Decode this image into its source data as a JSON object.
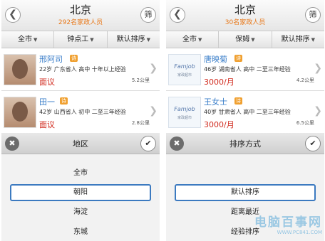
{
  "panels": [
    {
      "title": "北京",
      "subtitle": "292名家政人员",
      "back_icon": "chevron-left-icon",
      "filter_label": "筛",
      "tabs": [
        "全市",
        "钟点工",
        "默认排序"
      ],
      "items": [
        {
          "name": "邢阿司",
          "badge": "诗",
          "info": "22岁 广东省人 高中 十年以上经验",
          "price": "面议",
          "distance": "5.2公里",
          "avatar": "photo"
        },
        {
          "name": "田一",
          "badge": "诗",
          "info": "42岁 山西省人 初中 二至三年经验",
          "price": "面议",
          "distance": "2.8公里",
          "avatar": "photo"
        }
      ],
      "sheet": {
        "title": "地区",
        "close_icon": "close-icon",
        "confirm_icon": "check-icon",
        "options": [
          "全市",
          "朝阳",
          "海淀",
          "东城"
        ],
        "selected_index": 1
      }
    },
    {
      "title": "北京",
      "subtitle": "30名家政人员",
      "back_icon": "chevron-left-icon",
      "filter_label": "筛",
      "tabs": [
        "全市",
        "保姆",
        "默认排序"
      ],
      "items": [
        {
          "name": "唐映菊",
          "badge": "诗",
          "info": "46岁 湖南省人 高中 二至三年经验",
          "price": "3000/月",
          "distance": "4.2公里",
          "avatar": "logo",
          "logo_text": "Famjob",
          "logo_sub": "家政超市"
        },
        {
          "name": "王女士",
          "badge": "诗",
          "info": "40岁 甘肃省人 高中 二至三年经验",
          "price": "3000/月",
          "distance": "6.5公里",
          "avatar": "logo",
          "logo_text": "Famjob",
          "logo_sub": "家政超市"
        }
      ],
      "sheet": {
        "title": "排序方式",
        "close_icon": "close-icon",
        "confirm_icon": "check-icon",
        "options": [
          "默认排序",
          "距离最近",
          "经验排序"
        ],
        "selected_index": 0
      }
    }
  ],
  "watermark": {
    "line1": "电脑百事网",
    "line2": "WWW.PC841.COM"
  },
  "colors": {
    "accent_blue": "#3c7ac0",
    "price_red": "#d12b1f",
    "subtitle_orange": "#e8791b",
    "name_blue": "#3a7ec9"
  }
}
